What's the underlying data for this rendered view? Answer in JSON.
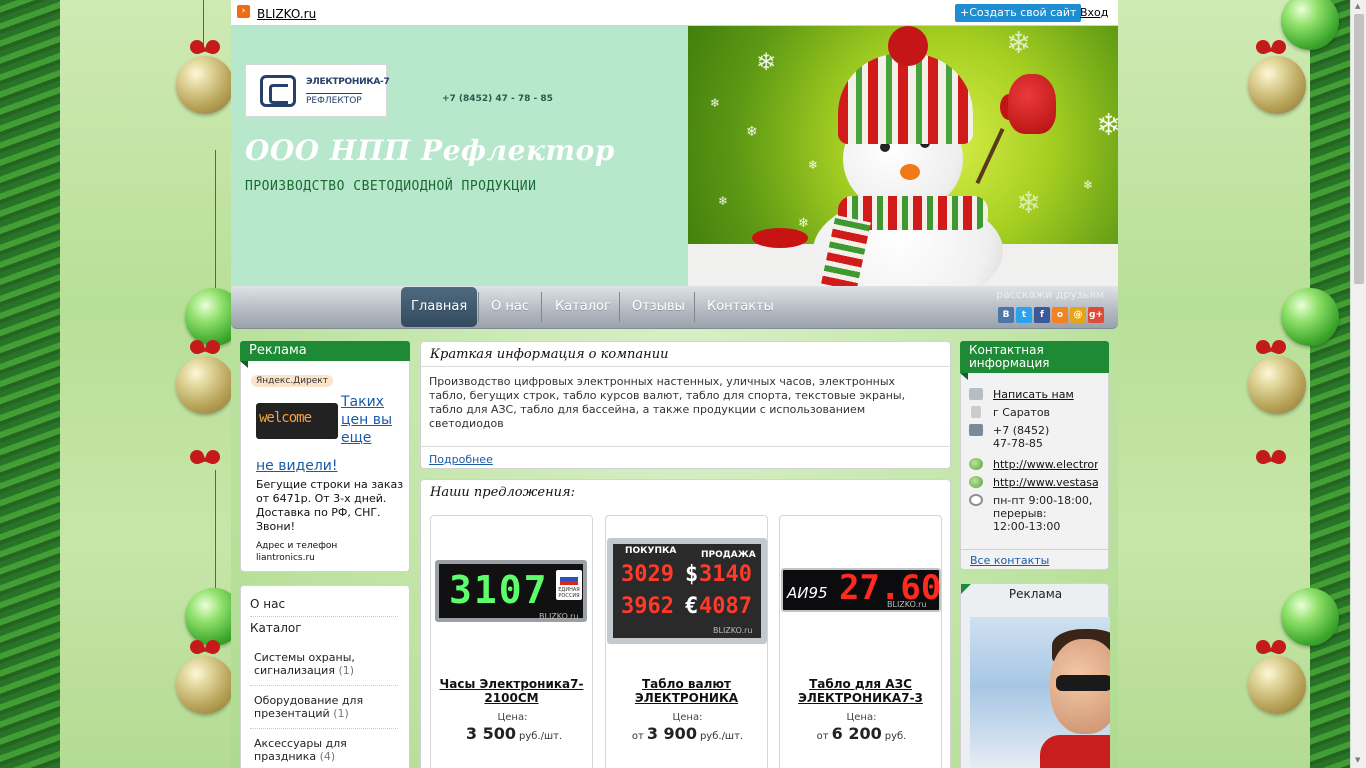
{
  "topbar": {
    "site_link": "BLIZKO.ru",
    "create_button": "+Создать свой сайт",
    "login": "Вход"
  },
  "header": {
    "logo_line1": "ЭЛЕКТРОНИКА-7",
    "logo_line2": "РЕФЛЕКТОР",
    "phone": "+7 (8452) 47 - 78 - 85",
    "company_name": "ООО НПП Рефлектор",
    "slogan": "ПРОИЗВОДСТВО СВЕТОДИОДНОЙ ПРОДУКЦИИ"
  },
  "nav": {
    "items": [
      "Главная",
      "О нас",
      "Каталог",
      "Отзывы",
      "Контакты"
    ],
    "active": "Главная",
    "share_label": "расскажи друзьям",
    "share_icons": [
      {
        "name": "vkontakte-icon",
        "glyph": "В",
        "color": "#4a76a8"
      },
      {
        "name": "twitter-icon",
        "glyph": "t",
        "color": "#2aa3ef"
      },
      {
        "name": "facebook-icon",
        "glyph": "f",
        "color": "#3b5998"
      },
      {
        "name": "odnoklassniki-icon",
        "glyph": "о",
        "color": "#f58220"
      },
      {
        "name": "mailru-icon",
        "glyph": "@",
        "color": "#e6a519"
      },
      {
        "name": "googleplus-icon",
        "glyph": "g+",
        "color": "#dd4b39"
      }
    ]
  },
  "ad_left": {
    "title": "Реклама",
    "badge": "Яндекс.Директ",
    "image_text": "welcome",
    "link_part1": "Таких цен вы еще",
    "link_part2": "не видели!",
    "text": "Бегущие строки на заказ от 6471р. От 3-х дней. Доставка по РФ, СНГ. Звони!",
    "footer_line1": "Адрес и телефон",
    "footer_line2": "liantronics.ru"
  },
  "left_menu": {
    "items": [
      "О нас",
      "Каталог"
    ],
    "subitems": [
      {
        "label": "Системы охраны, сигнализация",
        "count": "(1)"
      },
      {
        "label": "Оборудование для презентаций",
        "count": "(1)"
      },
      {
        "label": "Аксессуары для праздника",
        "count": "(4)"
      }
    ]
  },
  "about": {
    "title": "Краткая информация о компании",
    "text": "Производство цифровых электронных настенных, уличных часов, электронных табло, бегущих строк, табло курсов валют, табло для спорта, текстовые экраны, табло для АЗС, табло для бассейна, а также продукции с использованием светодиодов",
    "more": "Подробнее"
  },
  "offers": {
    "title": "Наши предложения:",
    "price_label": "Цена:",
    "products": [
      {
        "name": "Часы Электроника7-2100СМ",
        "prefix": "",
        "price": "3 500",
        "unit": "руб./шт.",
        "display": "3107",
        "badge_line1": "ЕДИНАЯ",
        "badge_line2": "РОССИЯ",
        "watermark": "BLIZKO.ru"
      },
      {
        "name": "Табло валют ЭЛЕКТРОНИКА",
        "prefix": "от",
        "price": "3 900",
        "unit": "руб./шт.",
        "head_buy": "ПОКУПКА",
        "head_sell": "ПРОДАЖА",
        "row1_left": "3029",
        "row1_right": "3140",
        "row2_left": "3962",
        "row2_right": "4087",
        "currency1": "$",
        "currency2": "€",
        "watermark": "BLIZKO.ru"
      },
      {
        "name": "Табло для АЗС ЭЛЕКТРОНИКА7-3",
        "prefix": "от",
        "price": "6 200",
        "unit": "руб.",
        "fuel": "АИ95",
        "display": "27.60",
        "watermark": "BLIZKO.ru"
      }
    ]
  },
  "contacts": {
    "title_line1": "Контактная",
    "title_line2": "информация",
    "write": "Написать нам",
    "city": "г Саратов",
    "phone_line1": "+7 (8452)",
    "phone_line2": "47-78-85",
    "site1": "http://www.electron",
    "site2": "http://www.vestasa",
    "hours_line1": "пн-пт 9:00-18:00,",
    "hours_line2": "перерыв:",
    "hours_line3": "12:00-13:00",
    "all": "Все контакты"
  },
  "ad_right": {
    "title": "Реклама"
  }
}
